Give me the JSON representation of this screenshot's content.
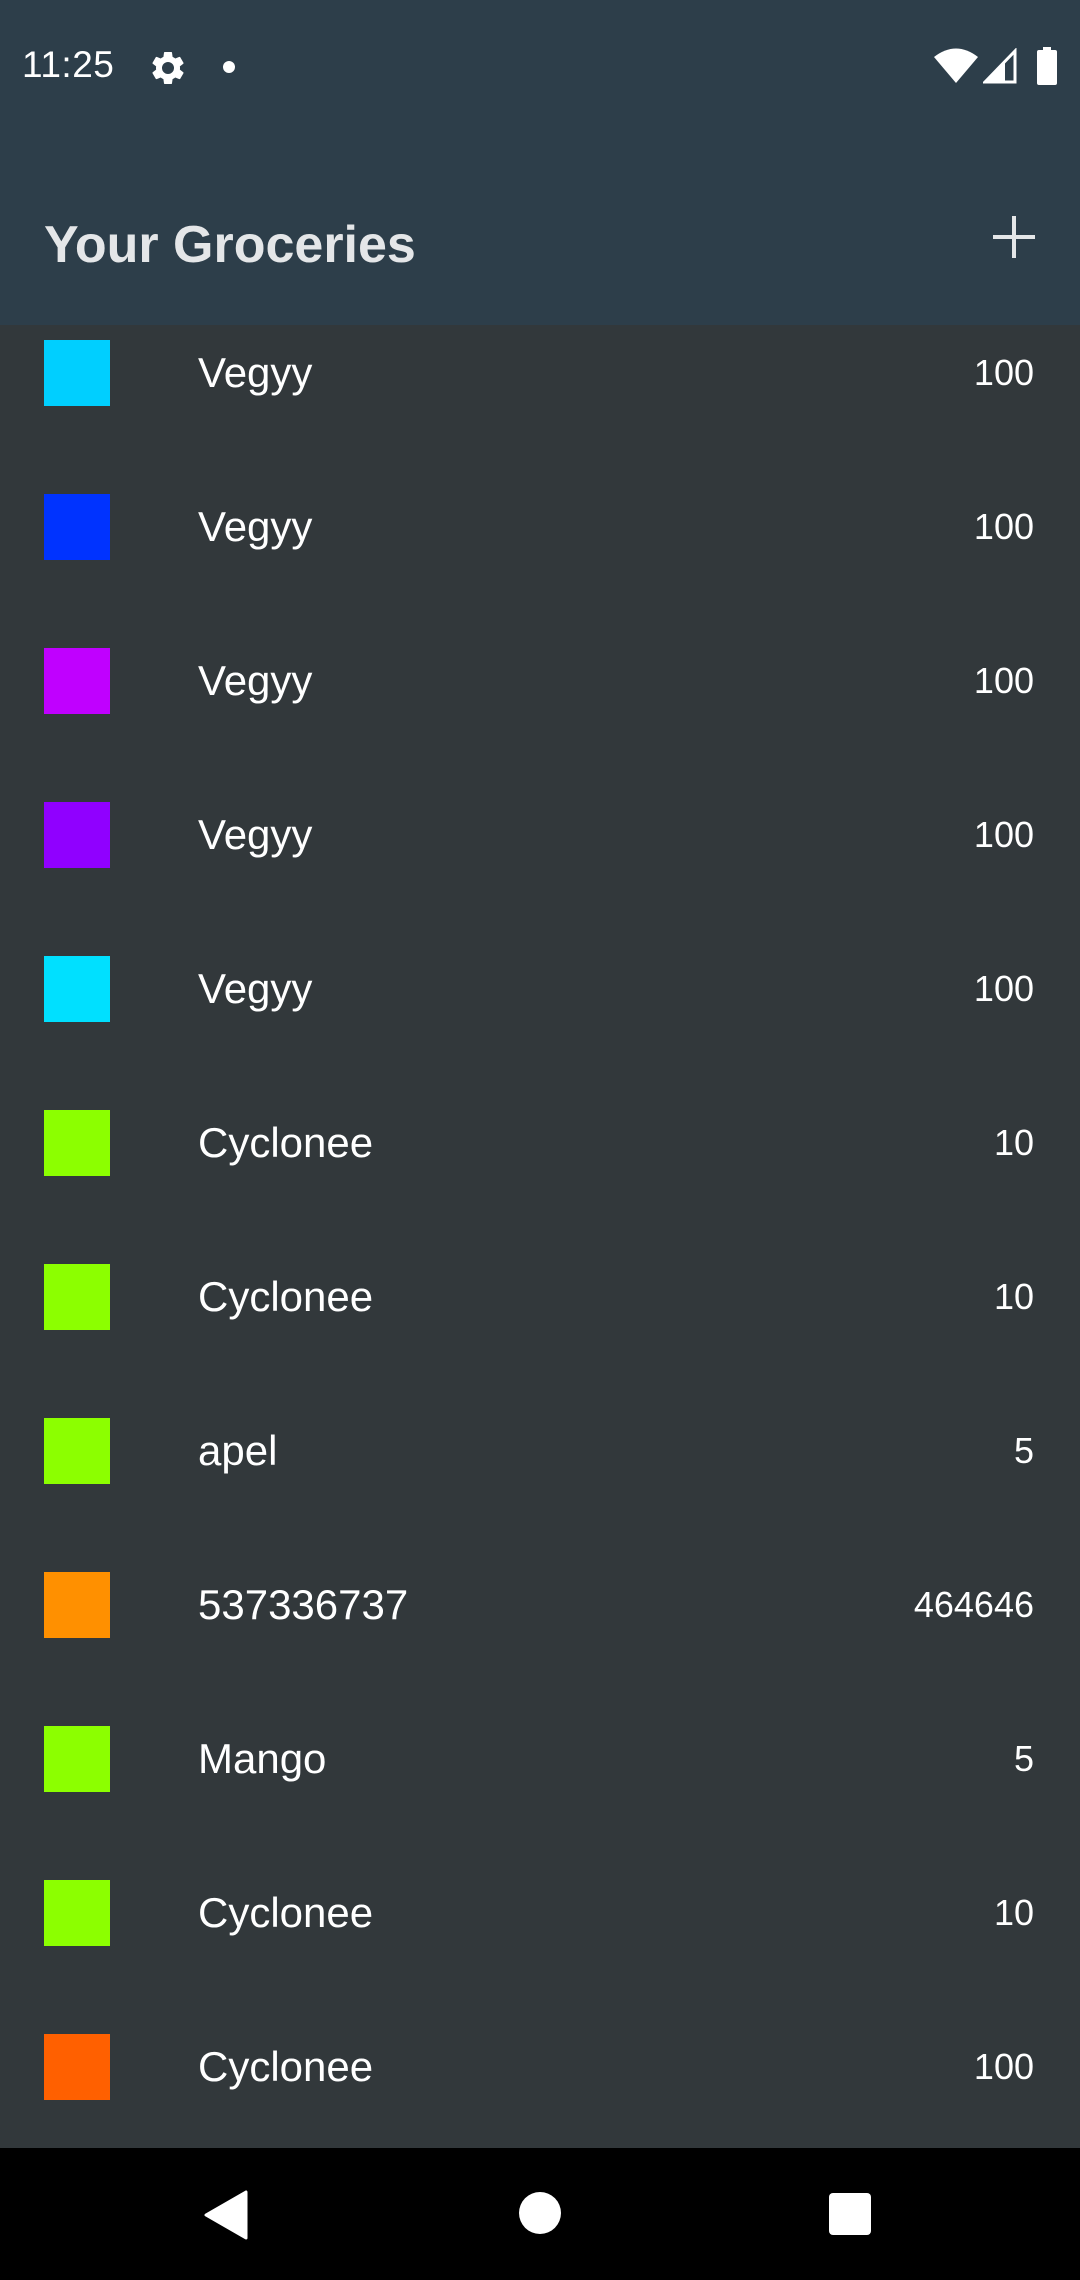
{
  "status_bar": {
    "time": "11:25",
    "icons": [
      "gear-icon",
      "notification-dot-icon",
      "wifi-icon",
      "signal-icon",
      "battery-icon"
    ]
  },
  "app_bar": {
    "title": "Your Groceries",
    "add_icon": "plus-icon"
  },
  "groceries": [
    {
      "name": "Vegyy",
      "quantity": "100",
      "color": "#00cfff"
    },
    {
      "name": "Vegyy",
      "quantity": "100",
      "color": "#0033ff"
    },
    {
      "name": "Vegyy",
      "quantity": "100",
      "color": "#c000ff"
    },
    {
      "name": "Vegyy",
      "quantity": "100",
      "color": "#9000ff"
    },
    {
      "name": "Vegyy",
      "quantity": "100",
      "color": "#00e0ff"
    },
    {
      "name": "Cyclonee",
      "quantity": "10",
      "color": "#8cff00"
    },
    {
      "name": "Cyclonee",
      "quantity": "10",
      "color": "#8cff00"
    },
    {
      "name": "apel",
      "quantity": "5",
      "color": "#8cff00"
    },
    {
      "name": "537336737",
      "quantity": "464646",
      "color": "#ff9000"
    },
    {
      "name": "Mango",
      "quantity": "5",
      "color": "#8cff00"
    },
    {
      "name": "Cyclonee",
      "quantity": "10",
      "color": "#8cff00"
    },
    {
      "name": "Cyclonee",
      "quantity": "100",
      "color": "#ff6000"
    }
  ],
  "nav_bar": {
    "icons": [
      "back-icon",
      "home-icon",
      "recents-icon"
    ]
  },
  "colors": {
    "header_background": "#2d3e4a",
    "list_background": "#32383b",
    "nav_background": "#000000"
  }
}
